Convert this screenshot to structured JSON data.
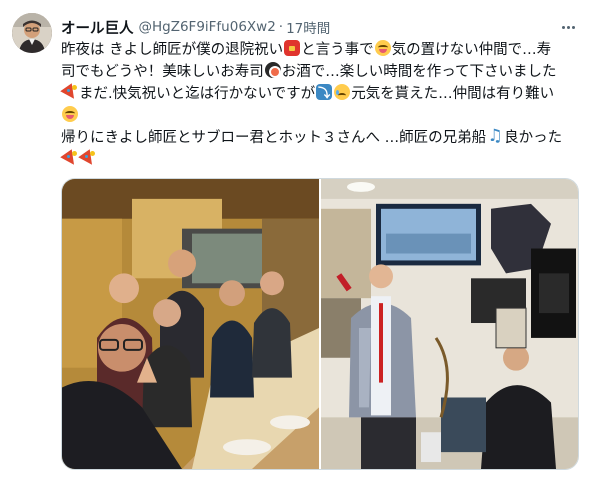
{
  "tweet": {
    "author": {
      "display_name": "オール巨人",
      "handle": "@HgZ6F9iFfu06Xw2",
      "separator": "·",
      "time": "17時間",
      "avatar_icon": "profile-avatar"
    },
    "more_icon": "more-options-icon",
    "text_lines": {
      "l1a": "昨夜は きよし師匠が僕の退院祝い",
      "l1b": "と言う事で",
      "l1c": "気の置けない仲間で…寿",
      "l2a": "司でもどうや！美味しいお寿司",
      "l2b": "お酒で…楽しい時間を作って下さいました",
      "l3a": "まだ.快気祝いと迄は行かないですが",
      "l3b": "元気を貰えた…仲間は有り難い",
      "l5a": "帰りにきよし師匠とサブロー君とホット３さんへ …師匠の兄弟船",
      "l5b": "良かった"
    },
    "emojis": {
      "red_envelope": "red-envelope-emoji",
      "smiling_face": "smiling-face-emoji",
      "sushi": "sushi-emoji",
      "party_popper": "party-popper-emoji",
      "arrow_down": "arrow-curving-down-emoji",
      "sad_relieved": "sad-but-relieved-face-emoji",
      "musical_notes": "musical-notes-emoji"
    },
    "media": {
      "photos": [
        {
          "name": "group-dinner-photo",
          "icon": "photo-group-at-restaurant"
        },
        {
          "name": "karaoke-singing-photo",
          "icon": "photo-man-singing-karaoke"
        }
      ]
    },
    "colors": {
      "text": "#0f1419",
      "secondary": "#536471",
      "border": "#cfd9de"
    }
  }
}
